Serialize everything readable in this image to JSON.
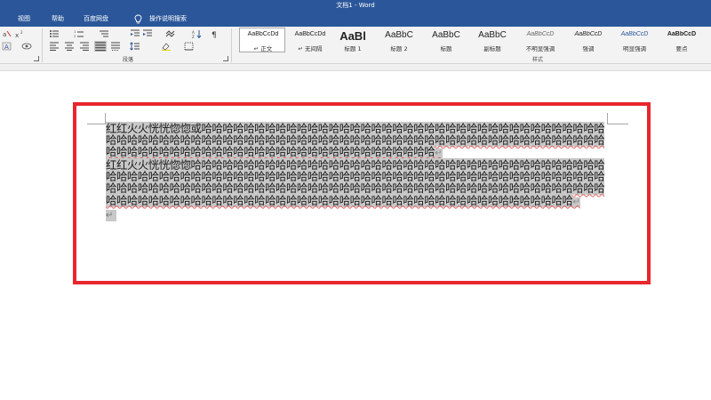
{
  "window": {
    "title": "文档1  -  Word"
  },
  "menu": {
    "view": "视图",
    "help": "帮助",
    "baidu_disk": "百度网盘",
    "tell_me": "操作说明搜索"
  },
  "ribbon": {
    "paragraph_label": "段落",
    "styles_label": "样式",
    "styles": [
      {
        "preview": "AaBbCcDd",
        "name": "↵ 正文",
        "size": 7
      },
      {
        "preview": "AaBbCcDd",
        "name": "↵ 无间隔",
        "size": 7
      },
      {
        "preview": "AaBl",
        "name": "标题 1",
        "size": 13
      },
      {
        "preview": "AaBbC",
        "name": "标题 2",
        "size": 10
      },
      {
        "preview": "AaBbC",
        "name": "标题",
        "size": 10
      },
      {
        "preview": "AaBbC",
        "name": "副标题",
        "size": 10
      },
      {
        "preview": "AaBbCcD",
        "name": "不明显强调",
        "size": 7
      },
      {
        "preview": "AaBbCcD",
        "name": "强调",
        "size": 7
      },
      {
        "preview": "AaBbCcD",
        "name": "明显强调",
        "size": 7
      },
      {
        "preview": "AaBbCcD",
        "name": "要点",
        "size": 7
      }
    ]
  },
  "document": {
    "paragraph1": "红红火火恍恍惚惚或哈哈哈哈哈哈哈哈哈哈哈哈哈哈哈哈哈哈哈哈哈哈哈哈哈哈哈哈哈哈哈哈哈哈哈哈哈哈哈哈哈哈哈哈哈哈哈哈哈哈哈哈哈哈哈哈哈哈哈哈哈哈哈哈哈哈哈哈哈哈哈哈哈哈哈哈哈哈哈哈哈哈哈哈哈哈哈哈哈哈哈哈哈哈哈哈哈哈哈哈哈哈哈哈哈哈哈哈哈哈哈哈哈哈哈哈",
    "paragraph2": "红红火火恍恍惚惚哈哈哈哈哈哈哈哈哈哈哈哈哈哈哈哈哈哈哈哈哈哈哈哈哈哈哈哈哈哈哈哈哈哈哈哈哈哈哈哈哈哈哈哈哈哈哈哈哈哈哈哈哈哈哈哈哈哈哈哈哈哈哈哈哈哈哈哈哈哈哈哈哈哈哈哈哈哈哈哈哈哈哈哈哈哈哈哈哈哈哈哈哈哈哈哈哈哈哈哈哈哈哈哈哈哈哈哈哈哈哈哈哈哈哈哈哈哈哈哈哈哈哈哈哈哈哈哈哈哈哈哈哈哈哈哈哈哈哈哈哈哈哈哈哈哈哈哈哈哈哈哈哈哈哈哈哈哈哈哈哈哈哈哈哈哈哈哈哈哈哈哈哈哈哈哈哈",
    "paragraph_mark": "↵"
  },
  "colors": {
    "title_bar": "#2b579a",
    "selection": "#c8c8c8",
    "annotation_frame": "#e8262c"
  }
}
